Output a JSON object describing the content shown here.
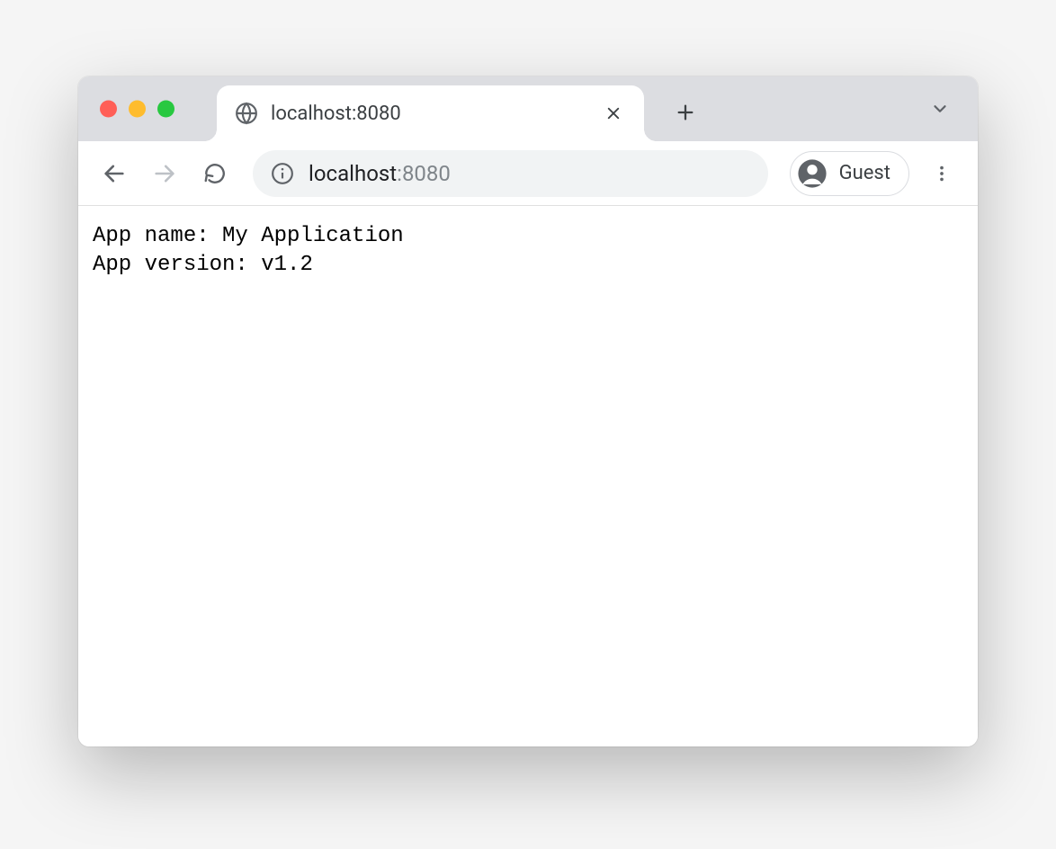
{
  "tab": {
    "title": "localhost:8080"
  },
  "addressbar": {
    "host": "localhost",
    "port": ":8080"
  },
  "profile": {
    "label": "Guest"
  },
  "page": {
    "line1": "App name: My Application",
    "line2": "App version: v1.2"
  }
}
